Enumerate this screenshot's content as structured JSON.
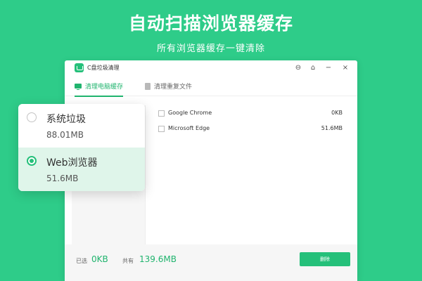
{
  "banner": {
    "headline": "自动扫描浏览器缓存",
    "subline": "所有浏览器缓存一键清除"
  },
  "window": {
    "title": "C盘垃圾清理",
    "controls": [
      "settings-icon",
      "skin-icon",
      "minimize-icon",
      "close-icon"
    ]
  },
  "tabs": [
    {
      "label": "清理电脑缓存",
      "active": true,
      "icon": "monitor-icon"
    },
    {
      "label": "清理重复文件",
      "active": false,
      "icon": "document-icon"
    }
  ],
  "categories": [
    {
      "name": "系统垃圾",
      "size": "88.01MB",
      "selected": false
    },
    {
      "name": "Web浏览器",
      "size": "51.6MB",
      "selected": true
    }
  ],
  "browsers": [
    {
      "name": "Google Chrome",
      "size": "0KB"
    },
    {
      "name": "Microsoft Edge",
      "size": "51.6MB"
    }
  ],
  "footer": {
    "selected_label": "已选",
    "selected_value": "0KB",
    "total_label": "共有",
    "total_value": "139.6MB",
    "delete_label": "删除"
  },
  "colors": {
    "background": "#2ecc89",
    "accent": "#25c07a",
    "selected_row": "#dff5ea"
  }
}
